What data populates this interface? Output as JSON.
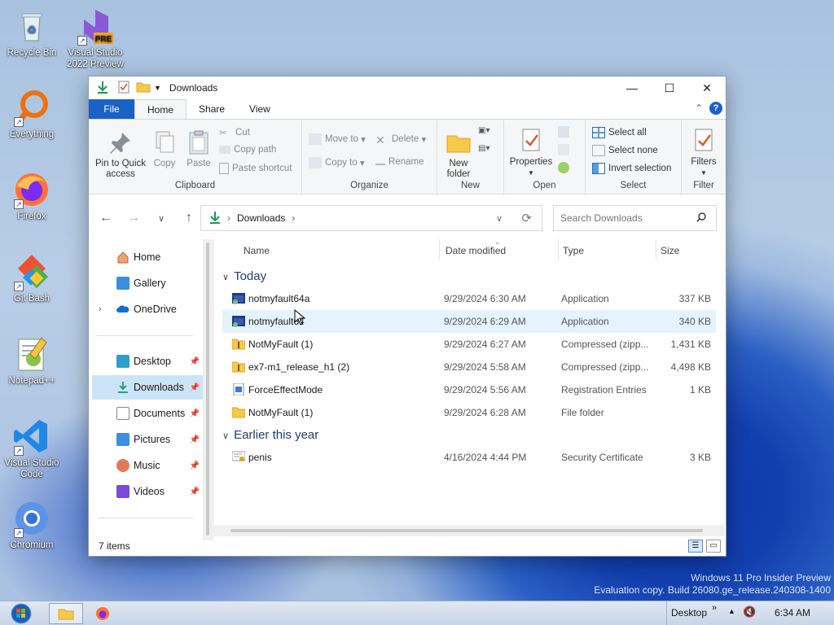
{
  "desktop": {
    "icons": [
      {
        "label": "Recycle Bin",
        "icon": "recycle-bin-icon",
        "badge": ""
      },
      {
        "label": "Visual Studio 2022 Preview",
        "icon": "visual-studio-preview-icon",
        "badge": "PRE"
      },
      {
        "label": "Everything",
        "icon": "everything-search-icon"
      },
      {
        "label": "Firefox",
        "icon": "firefox-icon"
      },
      {
        "label": "Git Bash",
        "icon": "git-bash-icon"
      },
      {
        "label": "Notepad++",
        "icon": "notepad-plus-plus-icon"
      },
      {
        "label": "Visual Studio Code",
        "icon": "vscode-icon"
      },
      {
        "label": "Chromium",
        "icon": "chromium-icon"
      }
    ]
  },
  "window": {
    "title": "Downloads",
    "controls": {
      "minimize": "—",
      "maximize": "☐",
      "close": "✕"
    }
  },
  "ribbon_tabs": [
    "File",
    "Home",
    "Share",
    "View"
  ],
  "ribbon": {
    "clipboard": {
      "pin": "Pin to Quick access",
      "copy": "Copy",
      "paste": "Paste",
      "cut": "Cut",
      "copy_path": "Copy path",
      "paste_shortcut": "Paste shortcut",
      "label": "Clipboard"
    },
    "organize": {
      "move_to": "Move to",
      "copy_to": "Copy to",
      "delete": "Delete",
      "rename": "Rename",
      "label": "Organize"
    },
    "new": {
      "new_folder": "New folder",
      "label": "New"
    },
    "open": {
      "properties": "Properties",
      "label": "Open"
    },
    "select": {
      "select_all": "Select all",
      "select_none": "Select none",
      "invert": "Invert selection",
      "label": "Select"
    },
    "filter": {
      "filters": "Filters",
      "label": "Filter"
    }
  },
  "address": {
    "path": "Downloads",
    "search_placeholder": "Search Downloads"
  },
  "nav_pane": {
    "items": [
      {
        "label": "Home",
        "icon": "home-icon"
      },
      {
        "label": "Gallery",
        "icon": "gallery-icon"
      },
      {
        "label": "OneDrive",
        "icon": "onedrive-icon"
      },
      {
        "label": "Desktop",
        "icon": "desktop-folder-icon"
      },
      {
        "label": "Downloads",
        "icon": "downloads-folder-icon"
      },
      {
        "label": "Documents",
        "icon": "documents-folder-icon"
      },
      {
        "label": "Pictures",
        "icon": "pictures-folder-icon"
      },
      {
        "label": "Music",
        "icon": "music-folder-icon"
      },
      {
        "label": "Videos",
        "icon": "videos-folder-icon"
      }
    ]
  },
  "columns": {
    "name": "Name",
    "date": "Date modified",
    "type": "Type",
    "size": "Size"
  },
  "groups": [
    {
      "title": "Today",
      "files": [
        {
          "name": "notmyfault64a",
          "date": "9/29/2024 6:30 AM",
          "type": "Application",
          "size": "337 KB",
          "icon": "application-icon"
        },
        {
          "name": "notmyfault64",
          "date": "9/29/2024 6:29 AM",
          "type": "Application",
          "size": "340 KB",
          "icon": "application-icon"
        },
        {
          "name": "NotMyFault (1)",
          "date": "9/29/2024 6:27 AM",
          "type": "Compressed (zipp...",
          "size": "1,431 KB",
          "icon": "zip-folder-icon"
        },
        {
          "name": "ex7-m1_release_h1 (2)",
          "date": "9/29/2024 5:58 AM",
          "type": "Compressed (zipp...",
          "size": "4,498 KB",
          "icon": "zip-folder-icon"
        },
        {
          "name": "ForceEffectMode",
          "date": "9/29/2024 5:56 AM",
          "type": "Registration Entries",
          "size": "1 KB",
          "icon": "registry-file-icon"
        },
        {
          "name": "NotMyFault (1)",
          "date": "9/29/2024 6:28 AM",
          "type": "File folder",
          "size": "",
          "icon": "folder-icon"
        }
      ]
    },
    {
      "title": "Earlier this year",
      "files": [
        {
          "name": "penis",
          "date": "4/16/2024 4:44 PM",
          "type": "Security Certificate",
          "size": "3 KB",
          "icon": "certificate-icon"
        }
      ]
    }
  ],
  "status": {
    "count": "7 items"
  },
  "taskbar": {
    "desktop_label": "Desktop",
    "chevron": "»",
    "time": "6:34 AM"
  },
  "watermark": {
    "line1": "Windows 11 Pro Insider Preview",
    "line2": "Evaluation copy. Build 26080.ge_release.240308-1400"
  }
}
